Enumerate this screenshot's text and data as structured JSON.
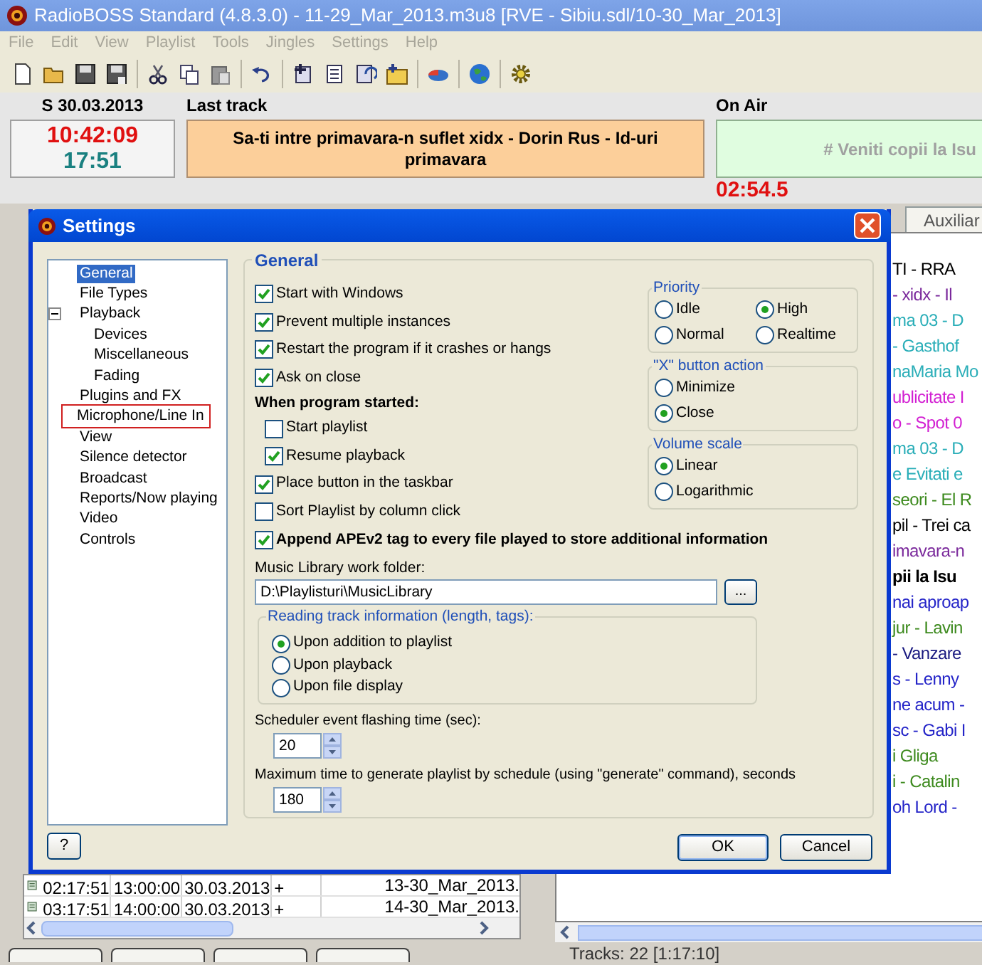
{
  "window": {
    "title": "RadioBOSS Standard (4.8.3.0) - 11-29_Mar_2013.m3u8 [RVE - Sibiu.sdl/10-30_Mar_2013]"
  },
  "menu": [
    {
      "label": "File",
      "disabled": true
    },
    {
      "label": "Edit",
      "disabled": true
    },
    {
      "label": "View",
      "disabled": true
    },
    {
      "label": "Playlist",
      "disabled": true
    },
    {
      "label": "Tools",
      "disabled": true
    },
    {
      "label": "Jingles",
      "disabled": true
    },
    {
      "label": "Settings",
      "disabled": true
    },
    {
      "label": "Help",
      "disabled": true
    }
  ],
  "clock": {
    "date": "S 30.03.2013",
    "time": "10:42:09",
    "remaining": "17:51"
  },
  "last_track": {
    "label": "Last track",
    "text": "Sa-ti intre primavara-n suflet xidx - Dorin Rus - Id-uri primavara"
  },
  "on_air": {
    "label": "On Air",
    "text": "# Veniti copii la Isu",
    "elapsed": "02:54.5"
  },
  "left_playlist": {
    "rows": [
      {
        "column_1": "02:17:51",
        "column_2": "13:00:00",
        "column_3": "30.03.2013",
        "column_4": "+",
        "column_7": "13-30_Mar_2013."
      },
      {
        "column_1": "03:17:51",
        "column_2": "14:00:00",
        "column_3": "30.03.2013",
        "column_4": "+",
        "column_7": "14-30_Mar_2013."
      }
    ]
  },
  "right_playlist": {
    "tabs": [
      {
        "label": "Auxiliar",
        "selected": false
      }
    ],
    "tracks": [
      {
        "text": "TI - RRA",
        "color": "#000000",
        "bold": false
      },
      {
        "text": "- xidx - Il",
        "color": "#7b2a9c",
        "bold": false
      },
      {
        "text": "ma 03 - D",
        "color": "#2aaeb8",
        "bold": false
      },
      {
        "text": "- Gasthof",
        "color": "#2aaeb8",
        "bold": false
      },
      {
        "text": "naMaria Mo",
        "color": "#2aaeb8",
        "bold": false
      },
      {
        "text": "ublicitate I",
        "color": "#d21fd2",
        "bold": false
      },
      {
        "text": "o - Spot 0",
        "color": "#d21fd2",
        "bold": false
      },
      {
        "text": "ma 03 - D",
        "color": "#2aaeb8",
        "bold": false
      },
      {
        "text": "e Evitati e",
        "color": "#2aaeb8",
        "bold": false
      },
      {
        "text": "seori - El R",
        "color": "#3d8a1e",
        "bold": false
      },
      {
        "text": "pil - Trei ca",
        "color": "#000000",
        "bold": false
      },
      {
        "text": "imavara-n",
        "color": "#7b2a9c",
        "bold": false
      },
      {
        "text": "pii la Isu",
        "color": "#000000",
        "bold": true
      },
      {
        "text": "nai aproap",
        "color": "#2424c8",
        "bold": false
      },
      {
        "text": "jur - Lavin",
        "color": "#3d8a1e",
        "bold": false
      },
      {
        "text": "- Vanzare",
        "color": "#1a1a80",
        "bold": false
      },
      {
        "text": "s - Lenny",
        "color": "#2424c8",
        "bold": false
      },
      {
        "text": "ne acum -",
        "color": "#2424c8",
        "bold": false
      },
      {
        "text": "sc - Gabi I",
        "color": "#2424c8",
        "bold": false
      },
      {
        "text": "i Gliga",
        "color": "#3d8a1e",
        "bold": false
      },
      {
        "text": "i - Catalin",
        "color": "#3d8a1e",
        "bold": false
      },
      {
        "text": "oh Lord -",
        "color": "#2424c8",
        "bold": false
      }
    ],
    "status": "Tracks: 22 [1:17:10]"
  },
  "dialog": {
    "title": "Settings",
    "tree": [
      {
        "label": "General",
        "selected": true,
        "outlined": false
      },
      {
        "label": "File Types",
        "selected": false,
        "outlined": false
      },
      {
        "label": "Playback",
        "selected": false,
        "outlined": false,
        "expanded": true,
        "children": [
          {
            "label": "Devices",
            "selected": false,
            "outlined": false
          },
          {
            "label": "Miscellaneous",
            "selected": false,
            "outlined": false
          },
          {
            "label": "Fading",
            "selected": false,
            "outlined": false
          }
        ]
      },
      {
        "label": "Plugins and FX",
        "selected": false,
        "outlined": false
      },
      {
        "label": "Microphone/Line In",
        "selected": false,
        "outlined": true
      },
      {
        "label": "View",
        "selected": false,
        "outlined": false
      },
      {
        "label": "Silence detector",
        "selected": false,
        "outlined": false
      },
      {
        "label": "Broadcast",
        "selected": false,
        "outlined": false
      },
      {
        "label": "Reports/Now playing",
        "selected": false,
        "outlined": false
      },
      {
        "label": "Video",
        "selected": false,
        "outlined": false
      },
      {
        "label": "Controls",
        "selected": false,
        "outlined": false
      }
    ],
    "section_title": "General",
    "options": [
      {
        "kind": "checkbox",
        "label": "Start with Windows",
        "checked": true,
        "bold": false
      },
      {
        "kind": "checkbox",
        "label": "Prevent multiple instances",
        "checked": true,
        "bold": false
      },
      {
        "kind": "checkbox",
        "label": "Restart the program if it crashes or hangs",
        "checked": true,
        "bold": false
      },
      {
        "kind": "checkbox",
        "label": "Ask on close",
        "checked": true,
        "bold": false
      },
      {
        "kind": "heading",
        "label": "When program started:",
        "children": [
          {
            "label": "Start playlist",
            "checked": false
          },
          {
            "label": "Resume playback",
            "checked": true
          }
        ]
      },
      {
        "kind": "checkbox",
        "label": "Place button in the taskbar",
        "checked": true,
        "bold": false
      },
      {
        "kind": "checkbox",
        "label": "Sort Playlist by column click",
        "checked": false,
        "bold": false
      },
      {
        "kind": "checkbox",
        "label": "Append APEv2 tag to every file played to store additional information",
        "checked": true,
        "bold": true
      }
    ],
    "radio_groups": [
      {
        "title": "Priority",
        "kind": "grid",
        "options": [
          {
            "label": "Idle",
            "selected": false
          },
          {
            "label": "High",
            "selected": true
          },
          {
            "label": "Normal",
            "selected": false
          },
          {
            "label": "Realtime",
            "selected": false
          }
        ]
      },
      {
        "title": "\"X\" button action",
        "kind": "list",
        "options": [
          {
            "label": "Minimize",
            "selected": false
          },
          {
            "label": "Close",
            "selected": true
          }
        ]
      },
      {
        "title": "Volume scale",
        "kind": "list",
        "options": [
          {
            "label": "Linear",
            "selected": true
          },
          {
            "label": "Logarithmic",
            "selected": false
          }
        ]
      }
    ],
    "music_library": {
      "label": "Music Library work folder:",
      "value": "D:\\Playlisturi\\MusicLibrary",
      "browse": "..."
    },
    "reading": {
      "title": "Reading track information (length, tags):",
      "options": [
        {
          "label": "Upon addition to playlist",
          "selected": true
        },
        {
          "label": "Upon playback",
          "selected": false
        },
        {
          "label": "Upon file display",
          "selected": false
        }
      ]
    },
    "flashing": {
      "label": "Scheduler event flashing time (sec):",
      "value": "20"
    },
    "max_time": {
      "label": "Maximum time to generate playlist by schedule (using \"generate\" command), seconds",
      "value": "180"
    },
    "buttons": {
      "help": "?",
      "ok": "OK",
      "cancel": "Cancel"
    }
  }
}
